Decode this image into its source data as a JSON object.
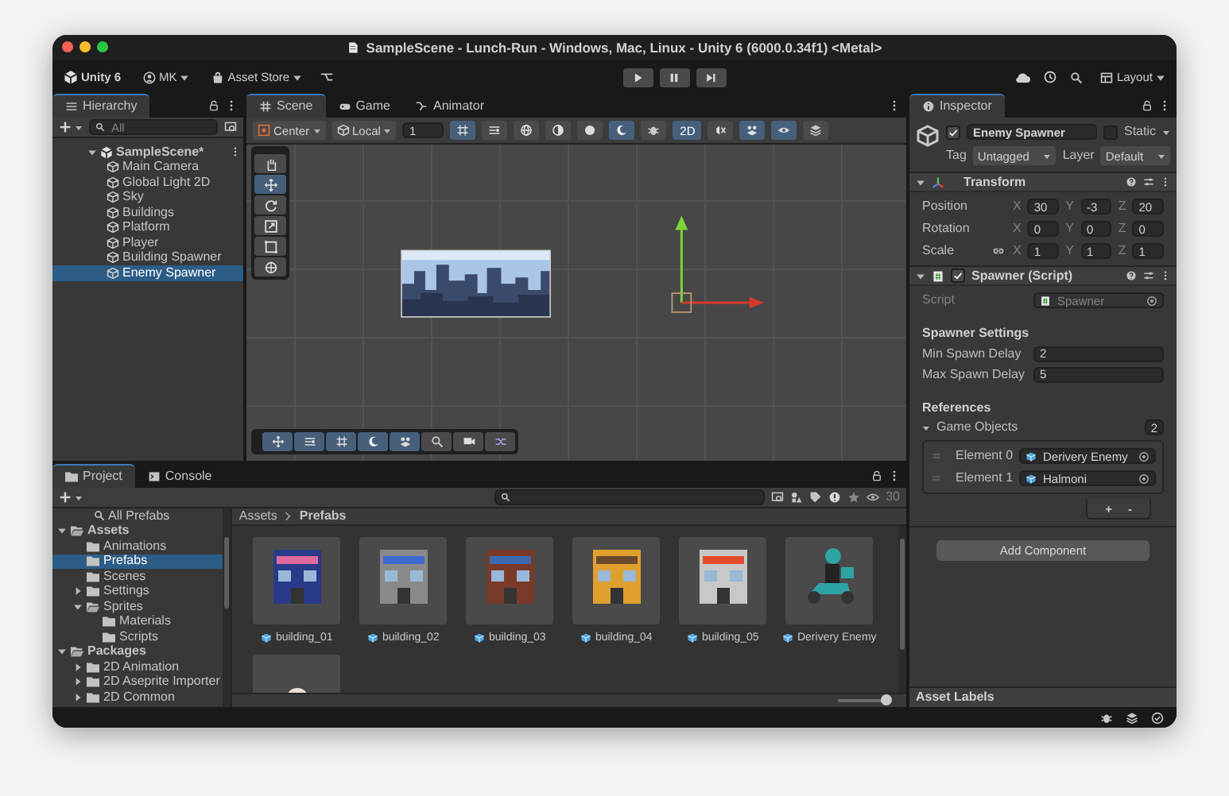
{
  "window": {
    "title": "SampleScene - Lunch-Run - Windows, Mac, Linux - Unity 6 (6000.0.34f1) <Metal>"
  },
  "toolbar": {
    "account": "Unity 6",
    "user": "MK",
    "store": "Asset Store",
    "layout": "Layout"
  },
  "hierarchy": {
    "title": "Hierarchy",
    "search_placeholder": "All",
    "scene": "SampleScene*",
    "items": [
      {
        "label": "Main Camera",
        "selected": false
      },
      {
        "label": "Global Light 2D",
        "selected": false
      },
      {
        "label": "Sky",
        "selected": false
      },
      {
        "label": "Buildings",
        "selected": false
      },
      {
        "label": "Platform",
        "selected": false
      },
      {
        "label": "Player",
        "selected": false
      },
      {
        "label": "Building Spawner",
        "selected": false
      },
      {
        "label": "Enemy Spawner",
        "selected": true
      }
    ]
  },
  "scene_view": {
    "tabs": [
      {
        "label": "Scene",
        "selected": true
      },
      {
        "label": "Game",
        "selected": false
      },
      {
        "label": "Animator",
        "selected": false
      }
    ],
    "pivot": "Center",
    "space": "Local",
    "grid_size": "1",
    "toggles": [
      {
        "kind": "grid",
        "on": true
      },
      {
        "kind": "snap",
        "on": false
      },
      {
        "kind": "wire",
        "on": false
      },
      {
        "kind": "shaded-wire",
        "on": false
      },
      {
        "kind": "shaded",
        "on": false
      },
      {
        "kind": "unlit",
        "on": true
      },
      {
        "kind": "debug",
        "on": false
      },
      {
        "kind": "mode",
        "label": "2D",
        "on": true
      },
      {
        "kind": "audio",
        "on": false
      },
      {
        "kind": "fx",
        "on": true
      },
      {
        "kind": "visibility",
        "on": true
      },
      {
        "kind": "layers",
        "on": false
      }
    ],
    "tools": [
      {
        "kind": "hand",
        "selected": false
      },
      {
        "kind": "move",
        "selected": true
      },
      {
        "kind": "rotate",
        "selected": false
      },
      {
        "kind": "scale",
        "selected": false
      },
      {
        "kind": "rect",
        "selected": false
      },
      {
        "kind": "transform",
        "selected": false
      }
    ],
    "overlay_tools": [
      {
        "kind": "move",
        "on": true
      },
      {
        "kind": "snap",
        "on": true
      },
      {
        "kind": "grid",
        "on": true
      },
      {
        "kind": "unlit",
        "on": true
      },
      {
        "kind": "fx",
        "on": true
      },
      {
        "kind": "search",
        "on": false
      },
      {
        "kind": "camera",
        "on": false
      },
      {
        "kind": "shuffle",
        "on": false
      }
    ]
  },
  "inspector": {
    "title": "Inspector",
    "object": {
      "active": true,
      "name": "Enemy Spawner",
      "static": false,
      "static_label": "Static",
      "tag_label": "Tag",
      "tag": "Untagged",
      "layer_label": "Layer",
      "layer": "Default"
    },
    "transform": {
      "title": "Transform",
      "rows": [
        {
          "label": "Position",
          "values": [
            {
              "axis": "X",
              "value": "30"
            },
            {
              "axis": "Y",
              "value": "-3"
            },
            {
              "axis": "Z",
              "value": "20"
            }
          ]
        },
        {
          "label": "Rotation",
          "values": [
            {
              "axis": "X",
              "value": "0"
            },
            {
              "axis": "Y",
              "value": "0"
            },
            {
              "axis": "Z",
              "value": "0"
            }
          ]
        },
        {
          "label": "Scale",
          "values": [
            {
              "axis": "X",
              "value": "1"
            },
            {
              "axis": "Y",
              "value": "1"
            },
            {
              "axis": "Z",
              "value": "1"
            }
          ]
        }
      ]
    },
    "spawner": {
      "title": "Spawner (Script)",
      "enabled": true,
      "script_label": "Script",
      "script": "Spawner",
      "settings_heading": "Spawner Settings",
      "fields": [
        {
          "label": "Min Spawn Delay",
          "value": "2"
        },
        {
          "label": "Max Spawn Delay",
          "value": "5"
        }
      ],
      "references_heading": "References",
      "list": {
        "label": "Game Objects",
        "expanded": true,
        "count": "2",
        "elements": [
          {
            "label": "Element 0",
            "value": "Derivery Enemy"
          },
          {
            "label": "Element 1",
            "value": "Halmoni"
          }
        ],
        "add": "+",
        "remove": "-"
      }
    },
    "add_component": "Add Component",
    "asset_labels": "Asset Labels"
  },
  "project": {
    "tabs": [
      {
        "label": "Project",
        "selected": true
      },
      {
        "label": "Console",
        "selected": false
      }
    ],
    "saved_search": "All Prefabs",
    "tree": [
      {
        "label": "Assets",
        "expanded": true,
        "selected": false,
        "children": [
          {
            "label": "Animations",
            "selected": false
          },
          {
            "label": "Prefabs",
            "selected": true
          },
          {
            "label": "Scenes",
            "selected": false
          },
          {
            "label": "Settings",
            "expanded": false,
            "selected": false
          },
          {
            "label": "Sprites",
            "expanded": true,
            "selected": false,
            "children": [
              {
                "label": "Materials",
                "selected": false
              },
              {
                "label": "Scripts",
                "selected": false
              }
            ]
          }
        ]
      },
      {
        "label": "Packages",
        "expanded": true,
        "selected": false,
        "children": [
          {
            "label": "2D Animation",
            "expanded": false,
            "selected": false
          },
          {
            "label": "2D Aseprite Importer",
            "expanded": false,
            "selected": false
          },
          {
            "label": "2D Common",
            "expanded": false,
            "selected": false
          }
        ]
      }
    ],
    "breadcrumb": [
      "Assets",
      "Prefabs"
    ],
    "hidden_count": "30",
    "assets": [
      {
        "kind": "building",
        "label": "building_01"
      },
      {
        "kind": "building",
        "label": "building_02"
      },
      {
        "kind": "building",
        "label": "building_03"
      },
      {
        "kind": "building",
        "label": "building_04"
      },
      {
        "kind": "building",
        "label": "building_05"
      },
      {
        "kind": "scooter",
        "label": "Derivery Enemy"
      },
      {
        "kind": "grandma"
      }
    ],
    "zoom_slider": {
      "level": 0.95
    }
  }
}
